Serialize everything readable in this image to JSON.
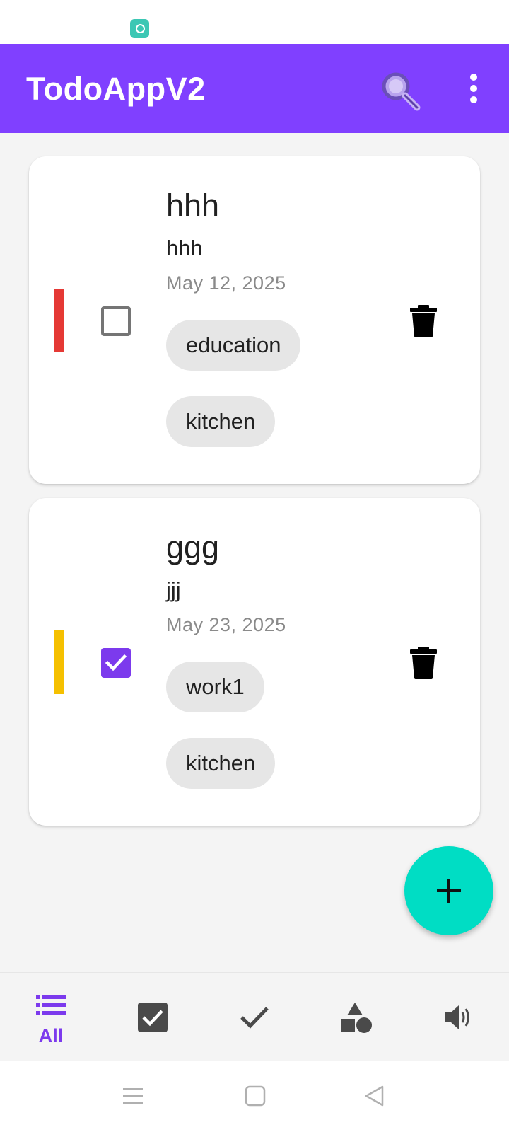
{
  "app": {
    "title": "TodoAppV2"
  },
  "colors": {
    "appbar": "#8040ff",
    "accent": "#7c3aed",
    "fab": "#00ddc4",
    "priority_high": "#e53935",
    "priority_medium": "#f5c000"
  },
  "appbar": {
    "search_icon": "search-icon",
    "more_icon": "more-vert-icon"
  },
  "todos": [
    {
      "title": "hhh",
      "description": "hhh",
      "date": "May 12, 2025",
      "checked": false,
      "priority_color": "#e53935",
      "tags": [
        "education",
        "kitchen"
      ]
    },
    {
      "title": "ggg",
      "description": "jjj",
      "date": "May 23, 2025",
      "checked": true,
      "priority_color": "#f5c000",
      "tags": [
        "work1",
        "kitchen"
      ]
    }
  ],
  "fab": {
    "icon": "plus-icon"
  },
  "bottom_nav": {
    "items": [
      {
        "icon": "list-icon",
        "label": "All",
        "active": true
      },
      {
        "icon": "checkbox-icon",
        "active": false
      },
      {
        "icon": "check-icon",
        "active": false
      },
      {
        "icon": "shapes-icon",
        "active": false
      },
      {
        "icon": "volume-icon",
        "active": false
      }
    ]
  },
  "system_nav": {
    "items": [
      "menu-icon",
      "home-icon",
      "back-icon"
    ]
  }
}
